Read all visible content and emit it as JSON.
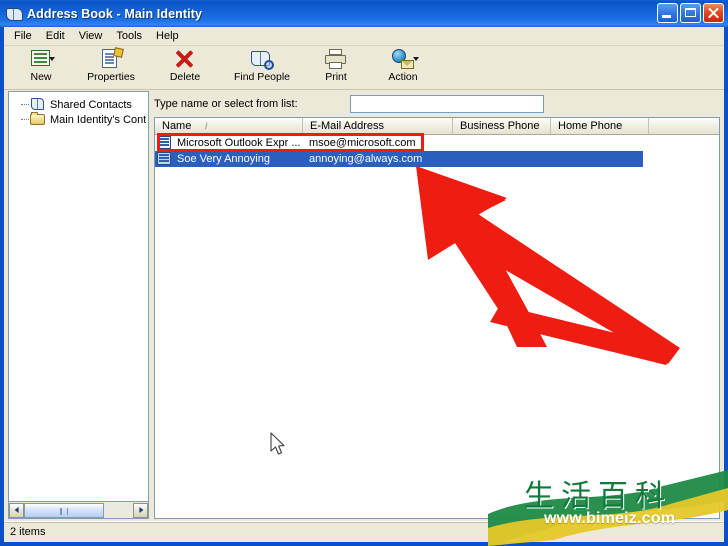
{
  "window": {
    "title": "Address Book - Main Identity",
    "icon": "address-book-icon",
    "controls": {
      "minimize": "Minimize",
      "maximize": "Maximize",
      "close": "Close"
    }
  },
  "menubar": {
    "items": [
      {
        "label": "File"
      },
      {
        "label": "Edit"
      },
      {
        "label": "View"
      },
      {
        "label": "Tools"
      },
      {
        "label": "Help"
      }
    ]
  },
  "toolbar": {
    "buttons": [
      {
        "label": "New",
        "icon": "new-contact-icon",
        "has_dropdown": true
      },
      {
        "label": "Properties",
        "icon": "properties-icon",
        "has_dropdown": false
      },
      {
        "label": "Delete",
        "icon": "delete-x-icon",
        "has_dropdown": false
      },
      {
        "label": "Find People",
        "icon": "find-people-icon",
        "has_dropdown": false
      },
      {
        "label": "Print",
        "icon": "printer-icon",
        "has_dropdown": false
      },
      {
        "label": "Action",
        "icon": "action-globe-icon",
        "has_dropdown": true
      }
    ]
  },
  "tree": {
    "items": [
      {
        "label": "Shared Contacts",
        "icon": "shared-contacts-book-icon"
      },
      {
        "label": "Main Identity's Conta",
        "icon": "contacts-folder-icon"
      }
    ]
  },
  "search": {
    "label": "Type name or select from list:",
    "value": "",
    "placeholder": ""
  },
  "list": {
    "columns": [
      {
        "label": "Name",
        "sort": "/"
      },
      {
        "label": "E-Mail Address",
        "sort": ""
      },
      {
        "label": "Business Phone",
        "sort": ""
      },
      {
        "label": "Home Phone",
        "sort": ""
      }
    ],
    "rows": [
      {
        "icon": "contact-card-icon",
        "name": "Microsoft Outlook Expr ...",
        "email": "msoe@microsoft.com",
        "business_phone": "",
        "home_phone": "",
        "selected": false
      },
      {
        "icon": "contact-card-icon",
        "name": "Soe Very Annoying",
        "email": "annoying@always.com",
        "business_phone": "",
        "home_phone": "",
        "selected": true
      }
    ]
  },
  "tree_scrollbar": {
    "left_arrow": "scroll-left-arrow",
    "right_arrow": "scroll-right-arrow"
  },
  "statusbar": {
    "text": "2 items"
  },
  "annotations": {
    "arrow": "red-pointer-arrow",
    "highlight_box": "red-highlight-rectangle"
  },
  "watermark": {
    "text": "生活百科",
    "url": "www.bimeiz.com"
  },
  "colors": {
    "titlebar_blue": "#0a53c4",
    "selection_blue": "#2a5fc0",
    "annotation_red": "#ee1c11",
    "window_face": "#ece9d8",
    "watermark_green": "#0f7a3c"
  }
}
